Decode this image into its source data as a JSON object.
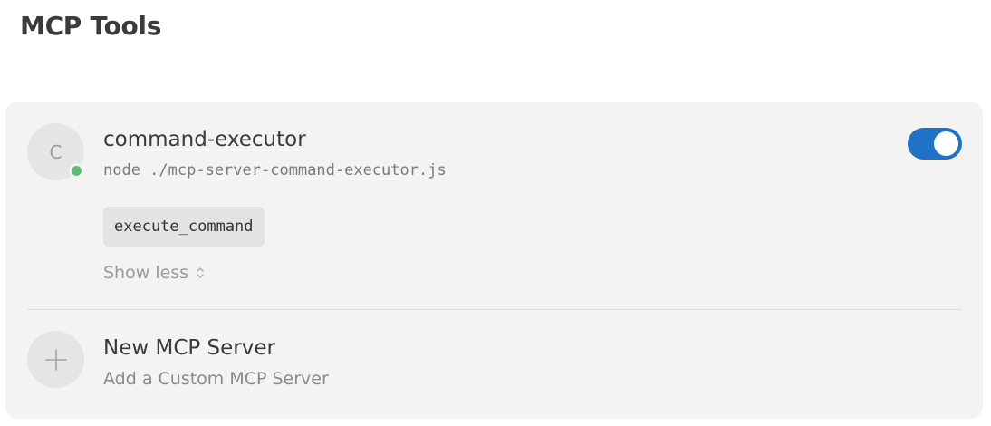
{
  "page": {
    "title": "MCP Tools"
  },
  "server": {
    "avatar_letter": "C",
    "status": "running",
    "status_color": "#5dbb7b",
    "name": "command-executor",
    "command": "node ./mcp-server-command-executor.js",
    "enabled": true,
    "toggle_color": "#1f72c8",
    "tools": [
      "execute_command"
    ],
    "show_less_label": "Show less",
    "show_less_icon": "chevron-up-down-icon"
  },
  "new_server": {
    "icon": "plus-icon",
    "title": "New MCP Server",
    "subtitle": "Add a Custom MCP Server"
  }
}
